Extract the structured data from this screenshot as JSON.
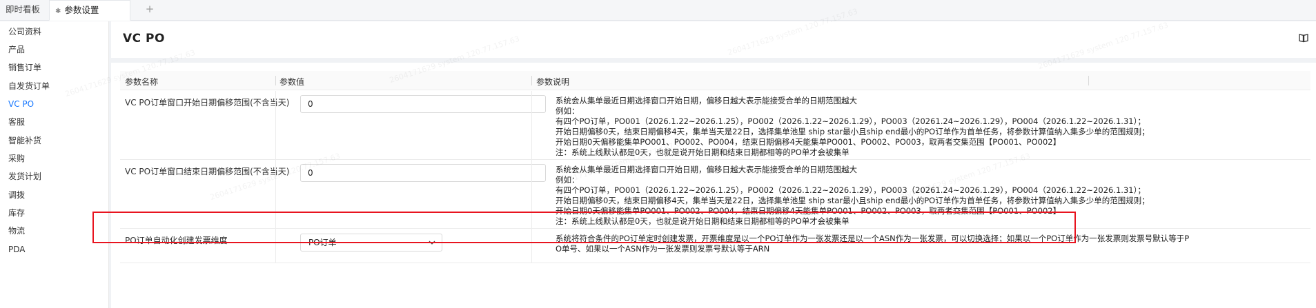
{
  "tabs": [
    {
      "label": "即时看板"
    },
    {
      "label": "参数设置",
      "icon": "pin-icon"
    },
    {
      "label": "+"
    }
  ],
  "sidebar": {
    "items": [
      {
        "label": "公司资料"
      },
      {
        "label": "产品"
      },
      {
        "label": "销售订单"
      },
      {
        "label": "自发货订单"
      },
      {
        "label": "VC PO",
        "active": true
      },
      {
        "label": "客服"
      },
      {
        "label": "智能补货"
      },
      {
        "label": "采购"
      },
      {
        "label": "发货计划"
      },
      {
        "label": "调拨"
      },
      {
        "label": "库存"
      },
      {
        "label": "物流"
      },
      {
        "label": "PDA"
      }
    ]
  },
  "header": {
    "title": "VC PO",
    "help_icon": "book-icon"
  },
  "table": {
    "columns": [
      "参数名称",
      "参数值",
      "参数说明"
    ],
    "rows": [
      {
        "name": "VC PO订单窗口开始日期偏移范围(不含当天)",
        "value": "0",
        "desc": [
          "系统会从集单最近日期选择窗口开始日期，偏移日越大表示能接受合单的日期范围越大",
          "例如：",
          "有四个PO订单，PO001（2026.1.22~2026.1.25），PO002（2026.1.22~2026.1.29），PO003（20261.24~2026.1.29），PO004（2026.1.22~2026.1.31）；",
          "开始日期偏移0天，结束日期偏移4天，集单当天是22日，选择集单池里 ship star最小且ship end最小的PO订单作为首单任务，将参数计算值纳入集多少单的范围规则；",
          "开始日期0天偏移能集单PO001、PO002、PO004，结束日期偏移4天能集单PO001、PO002、PO003，取两者交集范围【PO001、PO002】",
          "注：系统上线默认都是0天，也就是说开始日期和结束日期都相等的PO单才会被集单"
        ]
      },
      {
        "name": "VC PO订单窗口结束日期偏移范围(不含当天)",
        "value": "0",
        "desc": [
          "系统会从集单最近日期选择窗口开始日期，偏移日越大表示能接受合单的日期范围越大",
          "例如：",
          "有四个PO订单，PO001（2026.1.22~2026.1.25），PO002（2026.1.22~2026.1.29），PO003（20261.24~2026.1.29），PO004（2026.1.22~2026.1.31）；",
          "开始日期偏移0天，结束日期偏移4天，集单当天是22日，选择集单池里 ship star最小且ship end最小的PO订单作为首单任务，将参数计算值纳入集多少单的范围规则；",
          "开始日期0天偏移能集单PO001、PO002、PO004，结束日期偏移4天能集单PO001、PO002、PO003，取两者交集范围【PO001、PO002】",
          "注：系统上线默认都是0天，也就是说开始日期和结束日期都相等的PO单才会被集单"
        ]
      },
      {
        "name": "PO订单自动化创建发票维度",
        "value": "PO订单",
        "desc": [
          "系统将符合条件的PO订单定时创建发票，开票维度是以一个PO订单作为一张发票还是以一个ASN作为一张发票，可以切换选择；如果以一个PO订单作为一张发票则发票号默认等于P",
          "O单号、如果以一个ASN作为一张发票则发票号默认等于ARN"
        ]
      }
    ]
  },
  "watermark": "2604171629 system 120.77.157.63",
  "colors": {
    "accent": "#1677ff",
    "highlight": "#e8141f"
  }
}
